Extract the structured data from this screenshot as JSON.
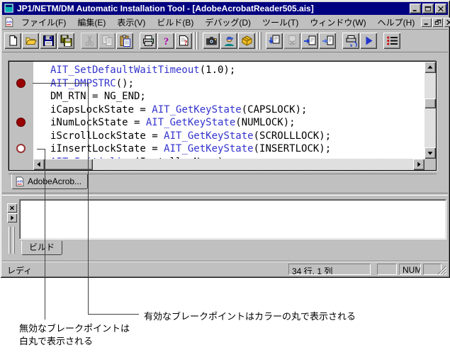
{
  "window": {
    "title": "JP1/NETM/DM Automatic Installation Tool - [AdobeAcrobatReader505.ais]",
    "controls": [
      "minimize",
      "maximize",
      "close"
    ],
    "mdi_controls": [
      "minimize",
      "restore",
      "close"
    ]
  },
  "menu": {
    "items": [
      "ファイル(F)",
      "編集(E)",
      "表示(V)",
      "ビルド(B)",
      "デバッグ(D)",
      "ツール(T)",
      "ウィンドウ(W)",
      "ヘルプ(H)"
    ]
  },
  "toolbar": {
    "buttons": [
      {
        "name": "new-file"
      },
      {
        "name": "open-file"
      },
      {
        "name": "save-file"
      },
      {
        "name": "save-all"
      },
      {
        "sep": true
      },
      {
        "name": "cut",
        "disabled": true
      },
      {
        "name": "copy",
        "disabled": true
      },
      {
        "name": "paste"
      },
      {
        "sep": true
      },
      {
        "name": "print"
      },
      {
        "name": "help"
      },
      {
        "name": "context-help"
      },
      {
        "grip": true
      },
      {
        "name": "screen-capture"
      },
      {
        "name": "wizard"
      },
      {
        "name": "package"
      },
      {
        "grip": true
      },
      {
        "name": "build-download"
      },
      {
        "name": "build-stop",
        "disabled": true
      },
      {
        "name": "build-import"
      },
      {
        "name": "build-send"
      },
      {
        "sep": true
      },
      {
        "name": "debug-output"
      },
      {
        "name": "run"
      },
      {
        "sep": true
      },
      {
        "name": "breakpoint-list"
      }
    ]
  },
  "editor": {
    "document_tab": "AdobeAcrob...",
    "lines": [
      {
        "breakpoint": null,
        "parts": [
          {
            "text": "AIT_SetDefaultWaitTimeout",
            "type": "function"
          },
          {
            "text": "(1.0);",
            "type": "plain"
          }
        ]
      },
      {
        "breakpoint": "enabled",
        "parts": [
          {
            "text": "AIT_DMPSTRC",
            "type": "function"
          },
          {
            "text": "();",
            "type": "plain"
          }
        ]
      },
      {
        "breakpoint": null,
        "parts": [
          {
            "text": "DM_RTN = NG_END;",
            "type": "plain"
          }
        ]
      },
      {
        "breakpoint": null,
        "parts": [
          {
            "text": "iCapsLockState = ",
            "type": "plain"
          },
          {
            "text": "AIT_GetKeyState",
            "type": "function"
          },
          {
            "text": "(CAPSLOCK);",
            "type": "plain"
          }
        ]
      },
      {
        "breakpoint": "enabled",
        "parts": [
          {
            "text": "iNumLockState = ",
            "type": "plain"
          },
          {
            "text": "AIT_GetKeyState",
            "type": "function"
          },
          {
            "text": "(NUMLOCK);",
            "type": "plain"
          }
        ]
      },
      {
        "breakpoint": null,
        "parts": [
          {
            "text": "iScrollLockState = ",
            "type": "plain"
          },
          {
            "text": "AIT_GetKeyState",
            "type": "function"
          },
          {
            "text": "(SCROLLLOCK);",
            "type": "plain"
          }
        ]
      },
      {
        "breakpoint": "disabled",
        "parts": [
          {
            "text": "iInsertLockState = ",
            "type": "plain"
          },
          {
            "text": "AIT_GetKeyState",
            "type": "function"
          },
          {
            "text": "(INSERTLOCK);",
            "type": "plain"
          }
        ]
      },
      {
        "breakpoint": null,
        "parts": [
          {
            "text": "AIT_Initialize",
            "type": "function"
          },
          {
            "text": "(InstallerName);",
            "type": "plain"
          }
        ]
      }
    ]
  },
  "output": {
    "tab": "ビルド"
  },
  "statusbar": {
    "message": "レディ",
    "caret_position": "34 行, 1 列",
    "num_lock": "NUM"
  },
  "annotations": {
    "enabled_breakpoint": "有効なブレークポイントはカラーの丸で表示される",
    "disabled_breakpoint_line1": "無効なブレークポイントは",
    "disabled_breakpoint_line2": "白丸で表示される"
  },
  "colors": {
    "titlebar": "#000080",
    "keyword": "#3333cc",
    "breakpoint_enabled": "#990000",
    "breakpoint_disabled_ring": "#993333"
  }
}
